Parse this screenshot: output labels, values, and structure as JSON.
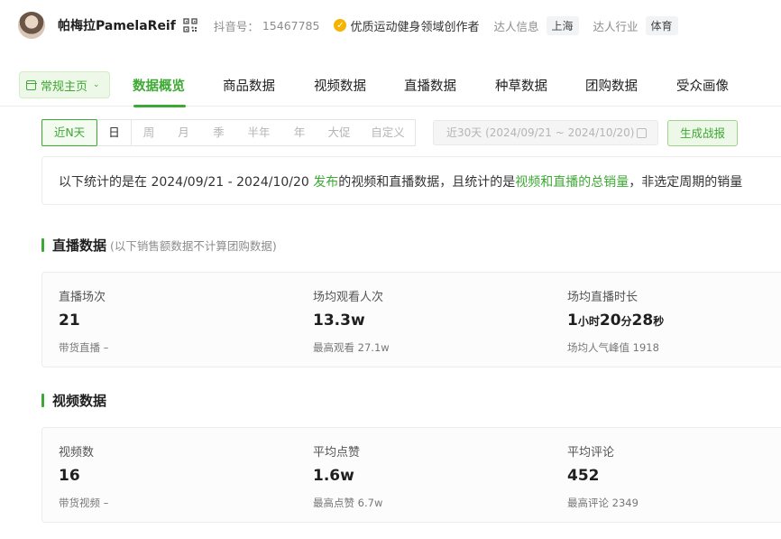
{
  "header": {
    "name": "帕梅拉PamelaReif",
    "douyin_label": "抖音号：",
    "douyin_id": "15467785",
    "badge": "优质运动健身领域创作者",
    "region_label": "达人信息",
    "region": "上海",
    "industry_label": "达人行业",
    "industry": "体育"
  },
  "nav": {
    "home": "常规主页",
    "tabs": [
      "数据概览",
      "商品数据",
      "视频数据",
      "直播数据",
      "种草数据",
      "团购数据",
      "受众画像"
    ],
    "active": "数据概览"
  },
  "filter": {
    "periods": [
      "近N天",
      "日",
      "周",
      "月",
      "季",
      "半年",
      "年",
      "大促",
      "自定义"
    ],
    "active_period": "近N天",
    "date_range": "近30天 (2024/09/21 ~ 2024/10/20)",
    "generate_button": "生成战报"
  },
  "info": {
    "part1": "以下统计的是在 2024/09/21 - 2024/10/20 ",
    "highlight1": "发布",
    "part2": "的视频和直播数据，且统计的是",
    "highlight2": "视频和直播的总销量",
    "part3": "，非选定周期的销量"
  },
  "live": {
    "title": "直播数据",
    "note": "(以下销售额数据不计算团购数据)",
    "stats": [
      {
        "label": "直播场次",
        "value": "21",
        "sub": "带货直播 –"
      },
      {
        "label": "场均观看人次",
        "value": "13.3w",
        "sub": "最高观看 27.1w"
      },
      {
        "label": "场均直播时长",
        "duration": {
          "h": "1",
          "h_unit": "小时",
          "m": "20",
          "m_unit": "分",
          "s": "28",
          "s_unit": "秒"
        },
        "sub": "场均人气峰值 1918"
      }
    ]
  },
  "video": {
    "title": "视频数据",
    "stats": [
      {
        "label": "视频数",
        "value": "16",
        "sub": "带货视频 –"
      },
      {
        "label": "平均点赞",
        "value": "1.6w",
        "sub": "最高点赞 6.7w"
      },
      {
        "label": "平均评论",
        "value": "452",
        "sub": "最高评论 2349"
      }
    ]
  },
  "colors": {
    "accent": "#3da934",
    "badge": "#f5b400"
  }
}
